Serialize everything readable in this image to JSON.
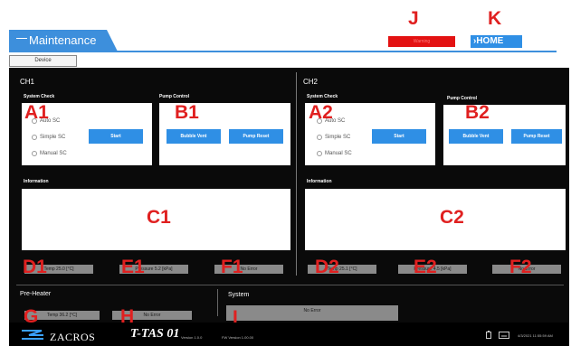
{
  "header": {
    "title": "Maintenance",
    "device_tab": "Device",
    "warning_label": "Warning",
    "home_label": "›HOME",
    "marker_j": "J",
    "marker_k": "K"
  },
  "channels": [
    {
      "name": "CH1",
      "system_check_label": "System Check",
      "pump_control_label": "Pump Control",
      "information_label": "Information",
      "radios": [
        "Auto SC",
        "Simple SC",
        "Manual SC"
      ],
      "start_label": "Start",
      "bubble_vent_label": "Bubble Vent",
      "pump_reset_label": "Pump Reset",
      "marker_a": "A1",
      "marker_b": "B1",
      "marker_c": "C1",
      "marker_d": "D1",
      "marker_e": "E1",
      "marker_f": "F1",
      "status_d": "Temp 25.0 [°C]",
      "status_e": "Pressure 5.2 [kPa]",
      "status_f": "No Error"
    },
    {
      "name": "CH2",
      "system_check_label": "System Check",
      "pump_control_label": "Pump Control",
      "information_label": "Information",
      "radios": [
        "Auto SC",
        "Simple SC",
        "Manual SC"
      ],
      "start_label": "Start",
      "bubble_vent_label": "Bubble Vent",
      "pump_reset_label": "Pump Reset",
      "marker_a": "A2",
      "marker_b": "B2",
      "marker_c": "C2",
      "marker_d": "D2",
      "marker_e": "E2",
      "marker_f": "F2",
      "status_d": "Temp 25.1 [°C]",
      "status_e": "Pressure 4.5 [kPa]",
      "status_f": "No Error"
    }
  ],
  "preheater": {
    "label": "Pre-Heater",
    "temp": "Temp 36.2 [°C]",
    "error": "No Error",
    "marker_g": "G",
    "marker_h": "H"
  },
  "system": {
    "label": "System",
    "error": "No Error",
    "marker_i": "I"
  },
  "footer": {
    "brand": "ZACROS",
    "product": "T-TAS 01",
    "version": "Version 1.0.0",
    "fw_version": "FW Version 1.00.00",
    "datetime": "4/3/2021 11:55:59 AM"
  },
  "colors": {
    "accent_blue": "#3d8fdc",
    "button_blue": "#2f8fe5",
    "warning_red": "#e31212",
    "marker_red": "#e02020",
    "panel_bg": "#0a0a0a"
  }
}
